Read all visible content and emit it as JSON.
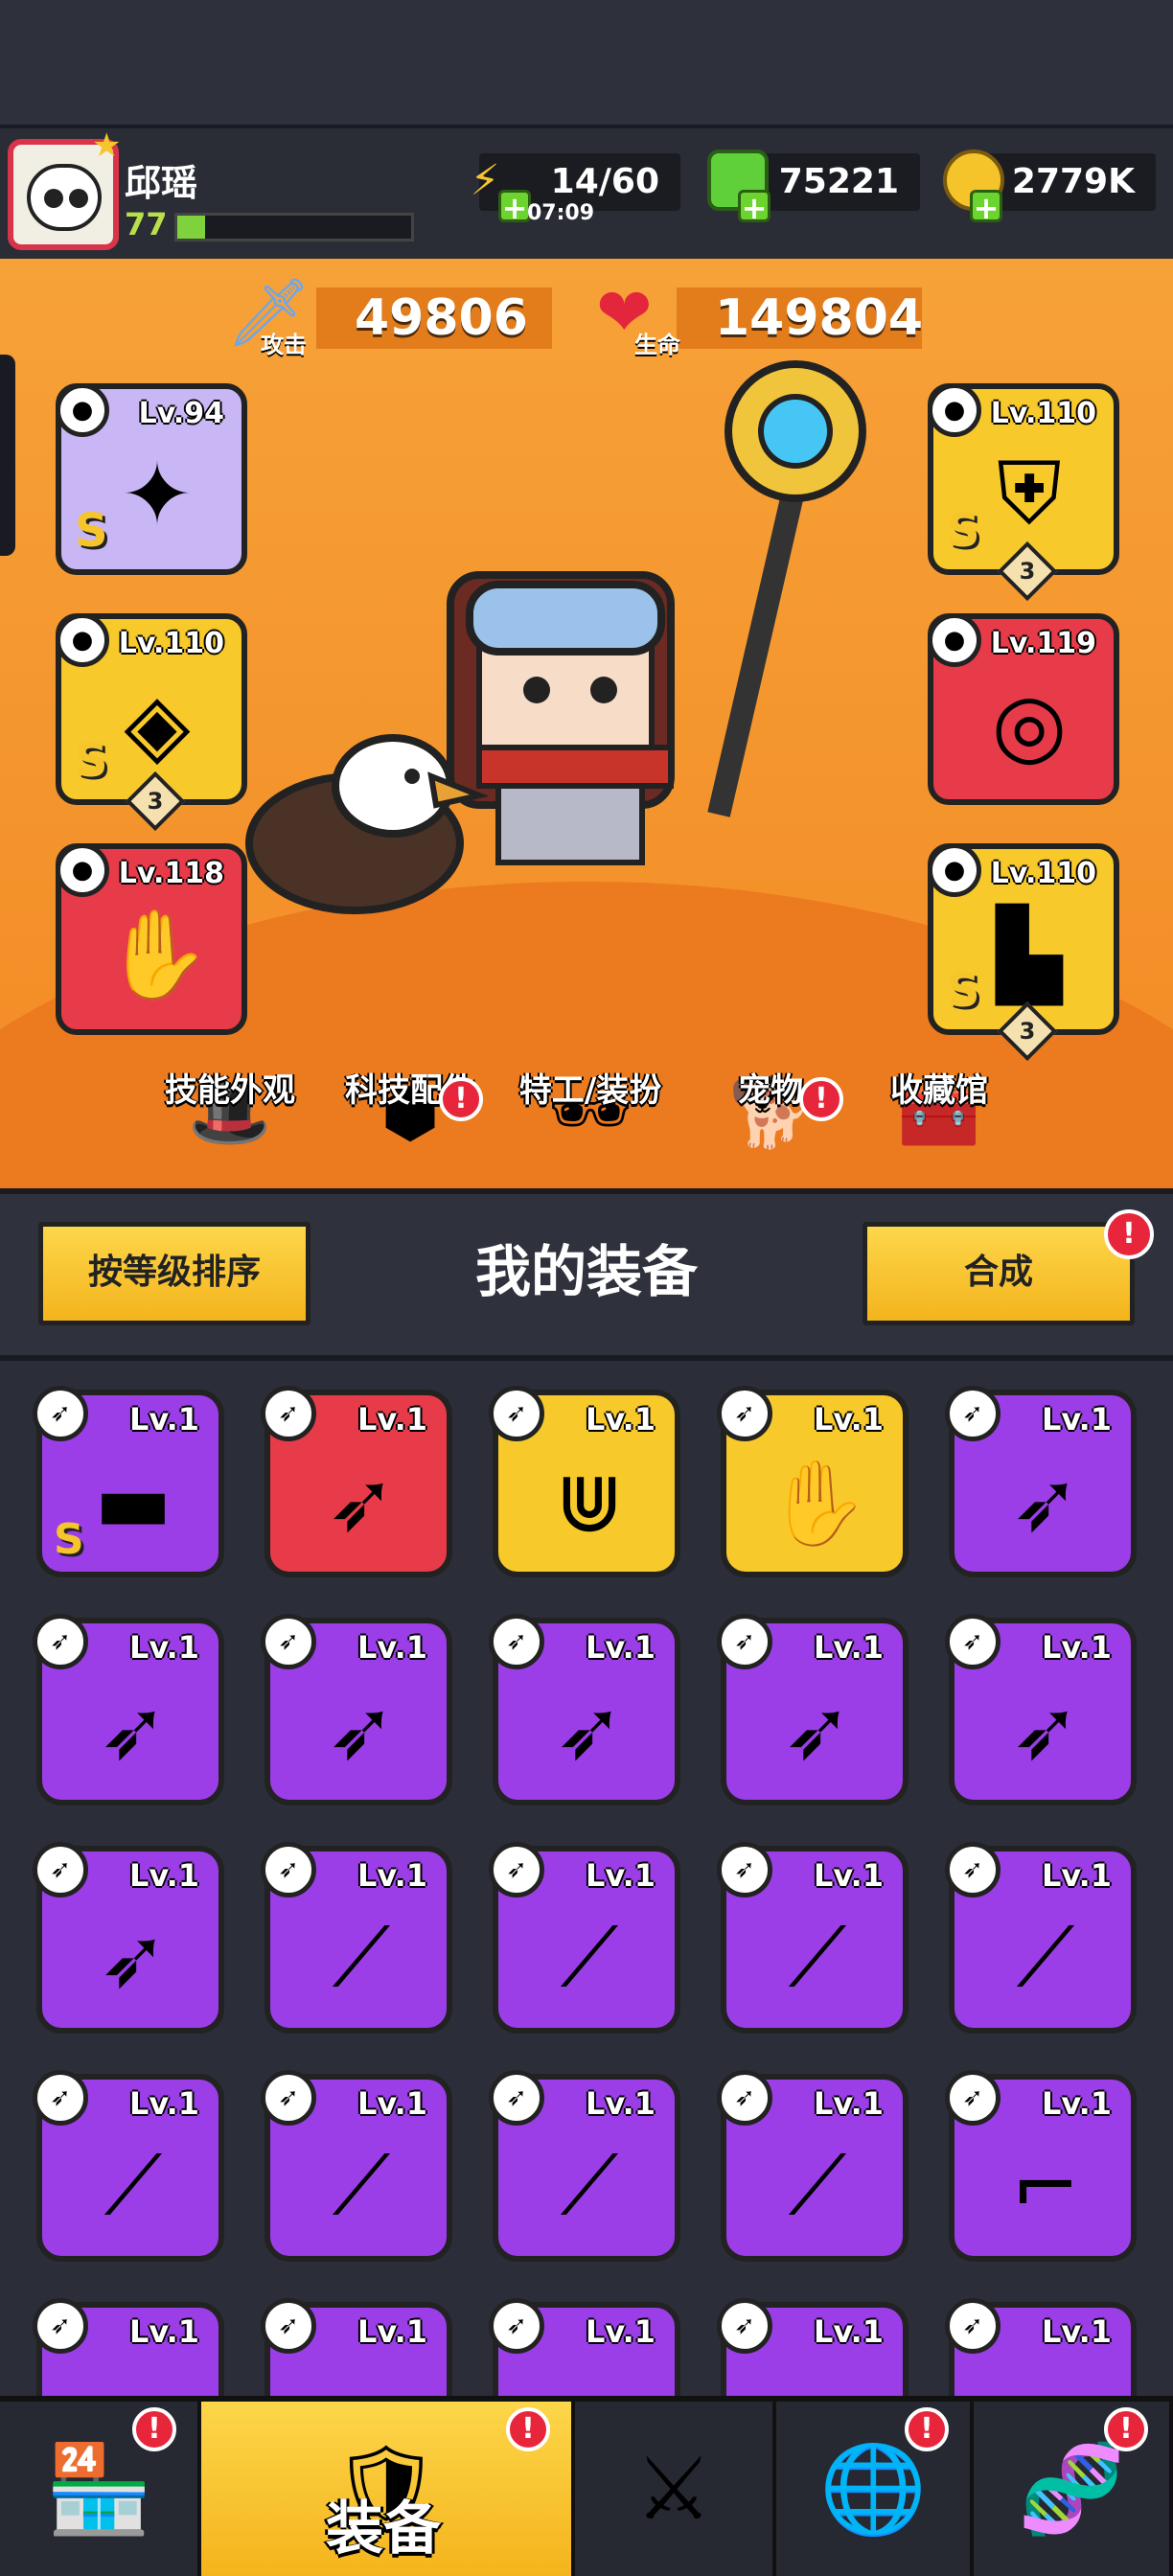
{
  "player": {
    "name": "邱瑶",
    "level": "77",
    "xp_fraction": 0.12
  },
  "resources": {
    "energy": "14/60",
    "energy_timer": "07:09",
    "gems": "75221",
    "coins": "2779K"
  },
  "stats": {
    "attack_value": "49806",
    "attack_label": "攻击",
    "hp_value": "149804",
    "hp_label": "生命"
  },
  "equipped": [
    {
      "slot": "weapon",
      "level": "Lv.94",
      "rarity": "S",
      "color": "#c9b6f5",
      "icon": "staff-icon"
    },
    {
      "slot": "armor",
      "level": "Lv.110",
      "rarity": "S",
      "stars": "3",
      "color": "#f7c92a",
      "icon": "armor-icon"
    },
    {
      "slot": "necklace",
      "level": "Lv.110",
      "rarity": "S",
      "stars": "3",
      "color": "#f7c92a",
      "icon": "necklace-icon"
    },
    {
      "slot": "belt",
      "level": "Lv.119",
      "rarity": "",
      "color": "#e83b4a",
      "icon": "belt-icon"
    },
    {
      "slot": "gloves",
      "level": "Lv.118",
      "rarity": "",
      "color": "#e83b4a",
      "icon": "glove-icon"
    },
    {
      "slot": "boots",
      "level": "Lv.110",
      "rarity": "S",
      "stars": "3",
      "color": "#f7c92a",
      "icon": "boots-icon"
    }
  ],
  "menu": [
    {
      "label": "技能外观",
      "alert": false
    },
    {
      "label": "科技配件",
      "alert": true
    },
    {
      "label": "特工/装扮",
      "alert": false
    },
    {
      "label": "宠物",
      "alert": true
    },
    {
      "label": "收藏馆",
      "alert": false
    }
  ],
  "inventory_bar": {
    "sort_button": "按等级排序",
    "title": "我的装备",
    "merge_button": "合成",
    "merge_alert": "!"
  },
  "inventory": [
    {
      "level": "Lv.1",
      "rarity": "S",
      "color": "#9b3ee8",
      "icon": "gun-icon"
    },
    {
      "level": "Lv.1",
      "rarity": "",
      "color": "#e83b4a",
      "icon": "kunai-icon"
    },
    {
      "level": "Lv.1",
      "rarity": "",
      "color": "#f7c92a",
      "icon": "fang-necklace-icon"
    },
    {
      "level": "Lv.1",
      "rarity": "",
      "color": "#f7c92a",
      "icon": "glove-icon"
    },
    {
      "level": "Lv.1",
      "rarity": "",
      "color": "#9b3ee8",
      "icon": "kunai-icon"
    },
    {
      "level": "Lv.1",
      "rarity": "",
      "color": "#9b3ee8",
      "icon": "kunai-icon"
    },
    {
      "level": "Lv.1",
      "rarity": "",
      "color": "#9b3ee8",
      "icon": "kunai-icon"
    },
    {
      "level": "Lv.1",
      "rarity": "",
      "color": "#9b3ee8",
      "icon": "kunai-icon"
    },
    {
      "level": "Lv.1",
      "rarity": "",
      "color": "#9b3ee8",
      "icon": "kunai-icon"
    },
    {
      "level": "Lv.1",
      "rarity": "",
      "color": "#9b3ee8",
      "icon": "kunai-icon"
    },
    {
      "level": "Lv.1",
      "rarity": "",
      "color": "#9b3ee8",
      "icon": "kunai-icon"
    },
    {
      "level": "Lv.1",
      "rarity": "",
      "color": "#9b3ee8",
      "icon": "katana-icon"
    },
    {
      "level": "Lv.1",
      "rarity": "",
      "color": "#9b3ee8",
      "icon": "katana-icon"
    },
    {
      "level": "Lv.1",
      "rarity": "",
      "color": "#9b3ee8",
      "icon": "katana-icon"
    },
    {
      "level": "Lv.1",
      "rarity": "",
      "color": "#9b3ee8",
      "icon": "katana-icon"
    },
    {
      "level": "Lv.1",
      "rarity": "",
      "color": "#9b3ee8",
      "icon": "katana-icon"
    },
    {
      "level": "Lv.1",
      "rarity": "",
      "color": "#9b3ee8",
      "icon": "katana-icon"
    },
    {
      "level": "Lv.1",
      "rarity": "",
      "color": "#9b3ee8",
      "icon": "katana-icon"
    },
    {
      "level": "Lv.1",
      "rarity": "",
      "color": "#9b3ee8",
      "icon": "katana-icon"
    },
    {
      "level": "Lv.1",
      "rarity": "",
      "color": "#9b3ee8",
      "icon": "revolver-icon"
    },
    {
      "level": "Lv.1",
      "rarity": "",
      "color": "#9b3ee8",
      "icon": "gun-icon"
    },
    {
      "level": "Lv.1",
      "rarity": "",
      "color": "#9b3ee8",
      "icon": "gun-icon"
    },
    {
      "level": "Lv.1",
      "rarity": "",
      "color": "#9b3ee8",
      "icon": "gun-icon"
    },
    {
      "level": "Lv.1",
      "rarity": "",
      "color": "#9b3ee8",
      "icon": "gun-icon"
    },
    {
      "level": "Lv.1",
      "rarity": "",
      "color": "#9b3ee8",
      "icon": "gun-icon"
    }
  ],
  "bottom_nav": {
    "active_label": "装备",
    "tabs": [
      {
        "icon": "shop-icon",
        "alert": true
      },
      {
        "icon": "equipment-icon",
        "alert": true
      },
      {
        "icon": "battle-icon",
        "alert": false
      },
      {
        "icon": "planet-icon",
        "alert": true
      },
      {
        "icon": "dna-capsule-icon",
        "alert": true
      }
    ]
  }
}
